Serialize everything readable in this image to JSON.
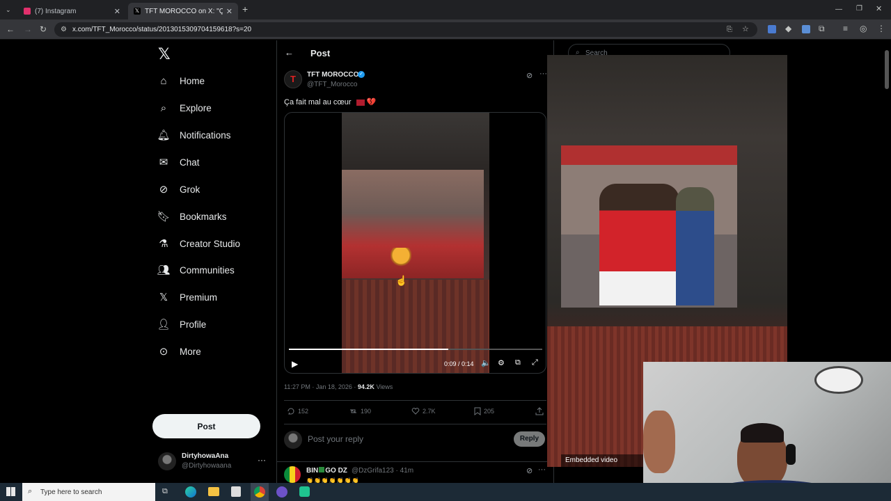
{
  "browser": {
    "tabs": [
      {
        "title": "(7) Instagram",
        "color": "#e1306c"
      },
      {
        "title": "TFT MOROCCO on X: \"Ça fait m",
        "color": "#ffffff"
      }
    ],
    "url": "x.com/TFT_Morocco/status/2013015309704159618?s=20"
  },
  "nav": {
    "items": [
      {
        "label": "Home",
        "icon": "home-icon"
      },
      {
        "label": "Explore",
        "icon": "search-icon"
      },
      {
        "label": "Notifications",
        "icon": "bell-icon"
      },
      {
        "label": "Chat",
        "icon": "mail-icon"
      },
      {
        "label": "Grok",
        "icon": "grok-icon"
      },
      {
        "label": "Bookmarks",
        "icon": "bookmark-icon"
      },
      {
        "label": "Creator Studio",
        "icon": "flask-icon"
      },
      {
        "label": "Communities",
        "icon": "people-icon"
      },
      {
        "label": "Premium",
        "icon": "x-icon"
      },
      {
        "label": "Profile",
        "icon": "person-icon"
      },
      {
        "label": "More",
        "icon": "more-icon"
      }
    ],
    "post_label": "Post",
    "account": {
      "name": "DirtyhowaAna",
      "handle": "@Dirtyhowaana"
    }
  },
  "header": {
    "title": "Post"
  },
  "tweet": {
    "author": "TFT MOROCCO",
    "handle": "@TFT_Morocco",
    "text": "Ça fait mal au cœur",
    "video": {
      "time": "0:09 / 0:14",
      "progress": 0.63
    },
    "meta_time": "11:27 PM · Jan 18, 2026 · ",
    "views": "94.2K",
    "views_label": " Views",
    "replies": "152",
    "reposts": "190",
    "likes": "2.7K",
    "bookmarks": "205"
  },
  "reply_box": {
    "placeholder": "Post your reply",
    "button": "Reply"
  },
  "reply": {
    "name": "BIN",
    "name2": "GO DZ",
    "handle": "@DzGrifa123 · 41m"
  },
  "right": {
    "search_placeholder": "Search",
    "embedded_label": "Embedded video"
  },
  "taskbar": {
    "search_placeholder": "Type here to search"
  }
}
